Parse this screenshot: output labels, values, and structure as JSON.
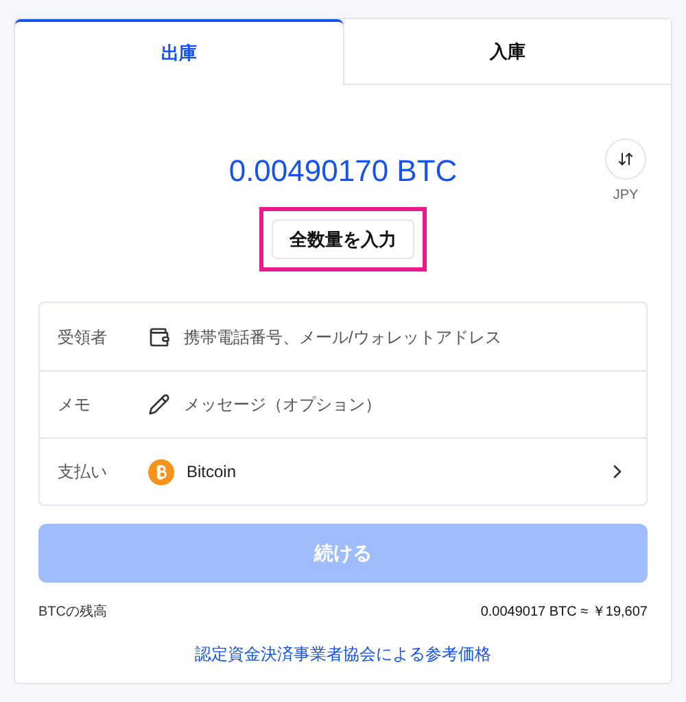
{
  "tabs": [
    {
      "label": "出庫",
      "selected": true
    },
    {
      "label": "入庫",
      "selected": false
    }
  ],
  "amount": {
    "value": "0.00490170 BTC",
    "toggle_label": "JPY"
  },
  "max_button": {
    "label": "全数量を入力",
    "highlighted": true
  },
  "form_rows": [
    {
      "kind": "address",
      "label": "受領者",
      "placeholder": "携帯電話番号、メール/ウォレットアドレス"
    },
    {
      "kind": "message",
      "label": "メモ",
      "placeholder": "メッセージ（オプション）"
    },
    {
      "kind": "coin",
      "label": "支払い",
      "value": "Bitcoin"
    }
  ],
  "continue_button": {
    "label": "続ける",
    "disabled": true
  },
  "balance": {
    "label": "BTCの残高",
    "value": "0.0049017 BTC ≈ ￥19,607"
  },
  "reference_link": "認定資金決済事業者協会による参考価格"
}
